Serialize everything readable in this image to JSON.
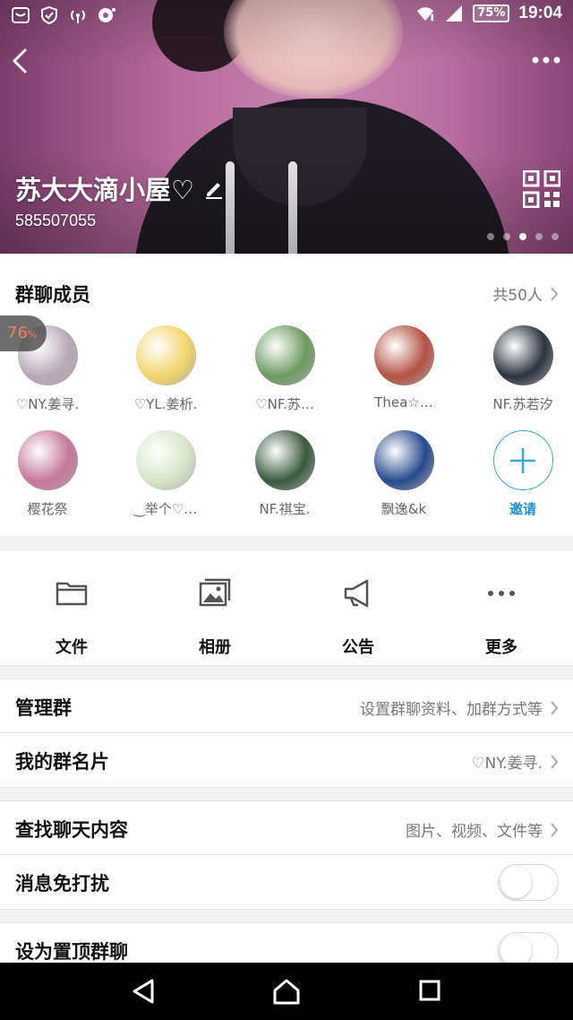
{
  "status_bar": {
    "battery": "75%",
    "time": "19:04"
  },
  "header": {
    "group_name": "苏大大滴小屋♡",
    "group_id": "585507055",
    "page_dots": 5,
    "active_dot": 2
  },
  "members": {
    "title": "群聊成员",
    "count": "共50人",
    "progress_badge": {
      "value": "76",
      "unit": "%"
    },
    "list": [
      {
        "name": "♡NY.姜寻.",
        "color": "#b9a9b8"
      },
      {
        "name": "♡YL.姜析.",
        "color": "#f1d56b"
      },
      {
        "name": "♡NF.苏…",
        "color": "#6d9a5f"
      },
      {
        "name": "Thea☆…",
        "color": "#b35243"
      },
      {
        "name": "NF.苏若汐",
        "color": "#2b3340"
      },
      {
        "name": "樱花祭",
        "color": "#c5779a"
      },
      {
        "name": "‿举个♡…",
        "color": "#d7e5c9"
      },
      {
        "name": "NF.祺宝.",
        "color": "#3a5a3c"
      },
      {
        "name": "飘逸&k",
        "color": "#274a8f"
      }
    ],
    "invite_label": "邀请"
  },
  "actions": [
    {
      "label": "文件",
      "icon": "folder-icon"
    },
    {
      "label": "相册",
      "icon": "album-icon"
    },
    {
      "label": "公告",
      "icon": "megaphone-icon"
    },
    {
      "label": "更多",
      "icon": "more-icon"
    }
  ],
  "settings": {
    "manage": {
      "label": "管理群",
      "value": "设置群聊资料、加群方式等"
    },
    "card": {
      "label": "我的群名片",
      "value": "♡NY.姜寻."
    },
    "search": {
      "label": "查找聊天内容",
      "value": "图片、视频、文件等"
    },
    "mute": {
      "label": "消息免打扰",
      "on": false
    },
    "pin": {
      "label": "设为置顶群聊",
      "on": false
    }
  },
  "colors": {
    "accent": "#1a95d6",
    "badge_text": "#f07f5a"
  }
}
